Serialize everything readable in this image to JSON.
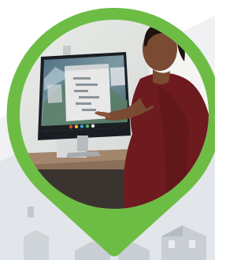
{
  "marker": {
    "icon": "map-pin-icon",
    "color": "#6dbd45"
  },
  "photo": {
    "subject": "person-touching-monitor-photo",
    "monitor": {
      "window_color": "#e8e8e8",
      "taskbar_color": "#1c1f24"
    },
    "shirt_color": "#6e1b1f",
    "skin_color": "#7a4a32"
  },
  "background": {
    "map_color": "#e3e6ea",
    "building_color": "#c9ced4"
  }
}
